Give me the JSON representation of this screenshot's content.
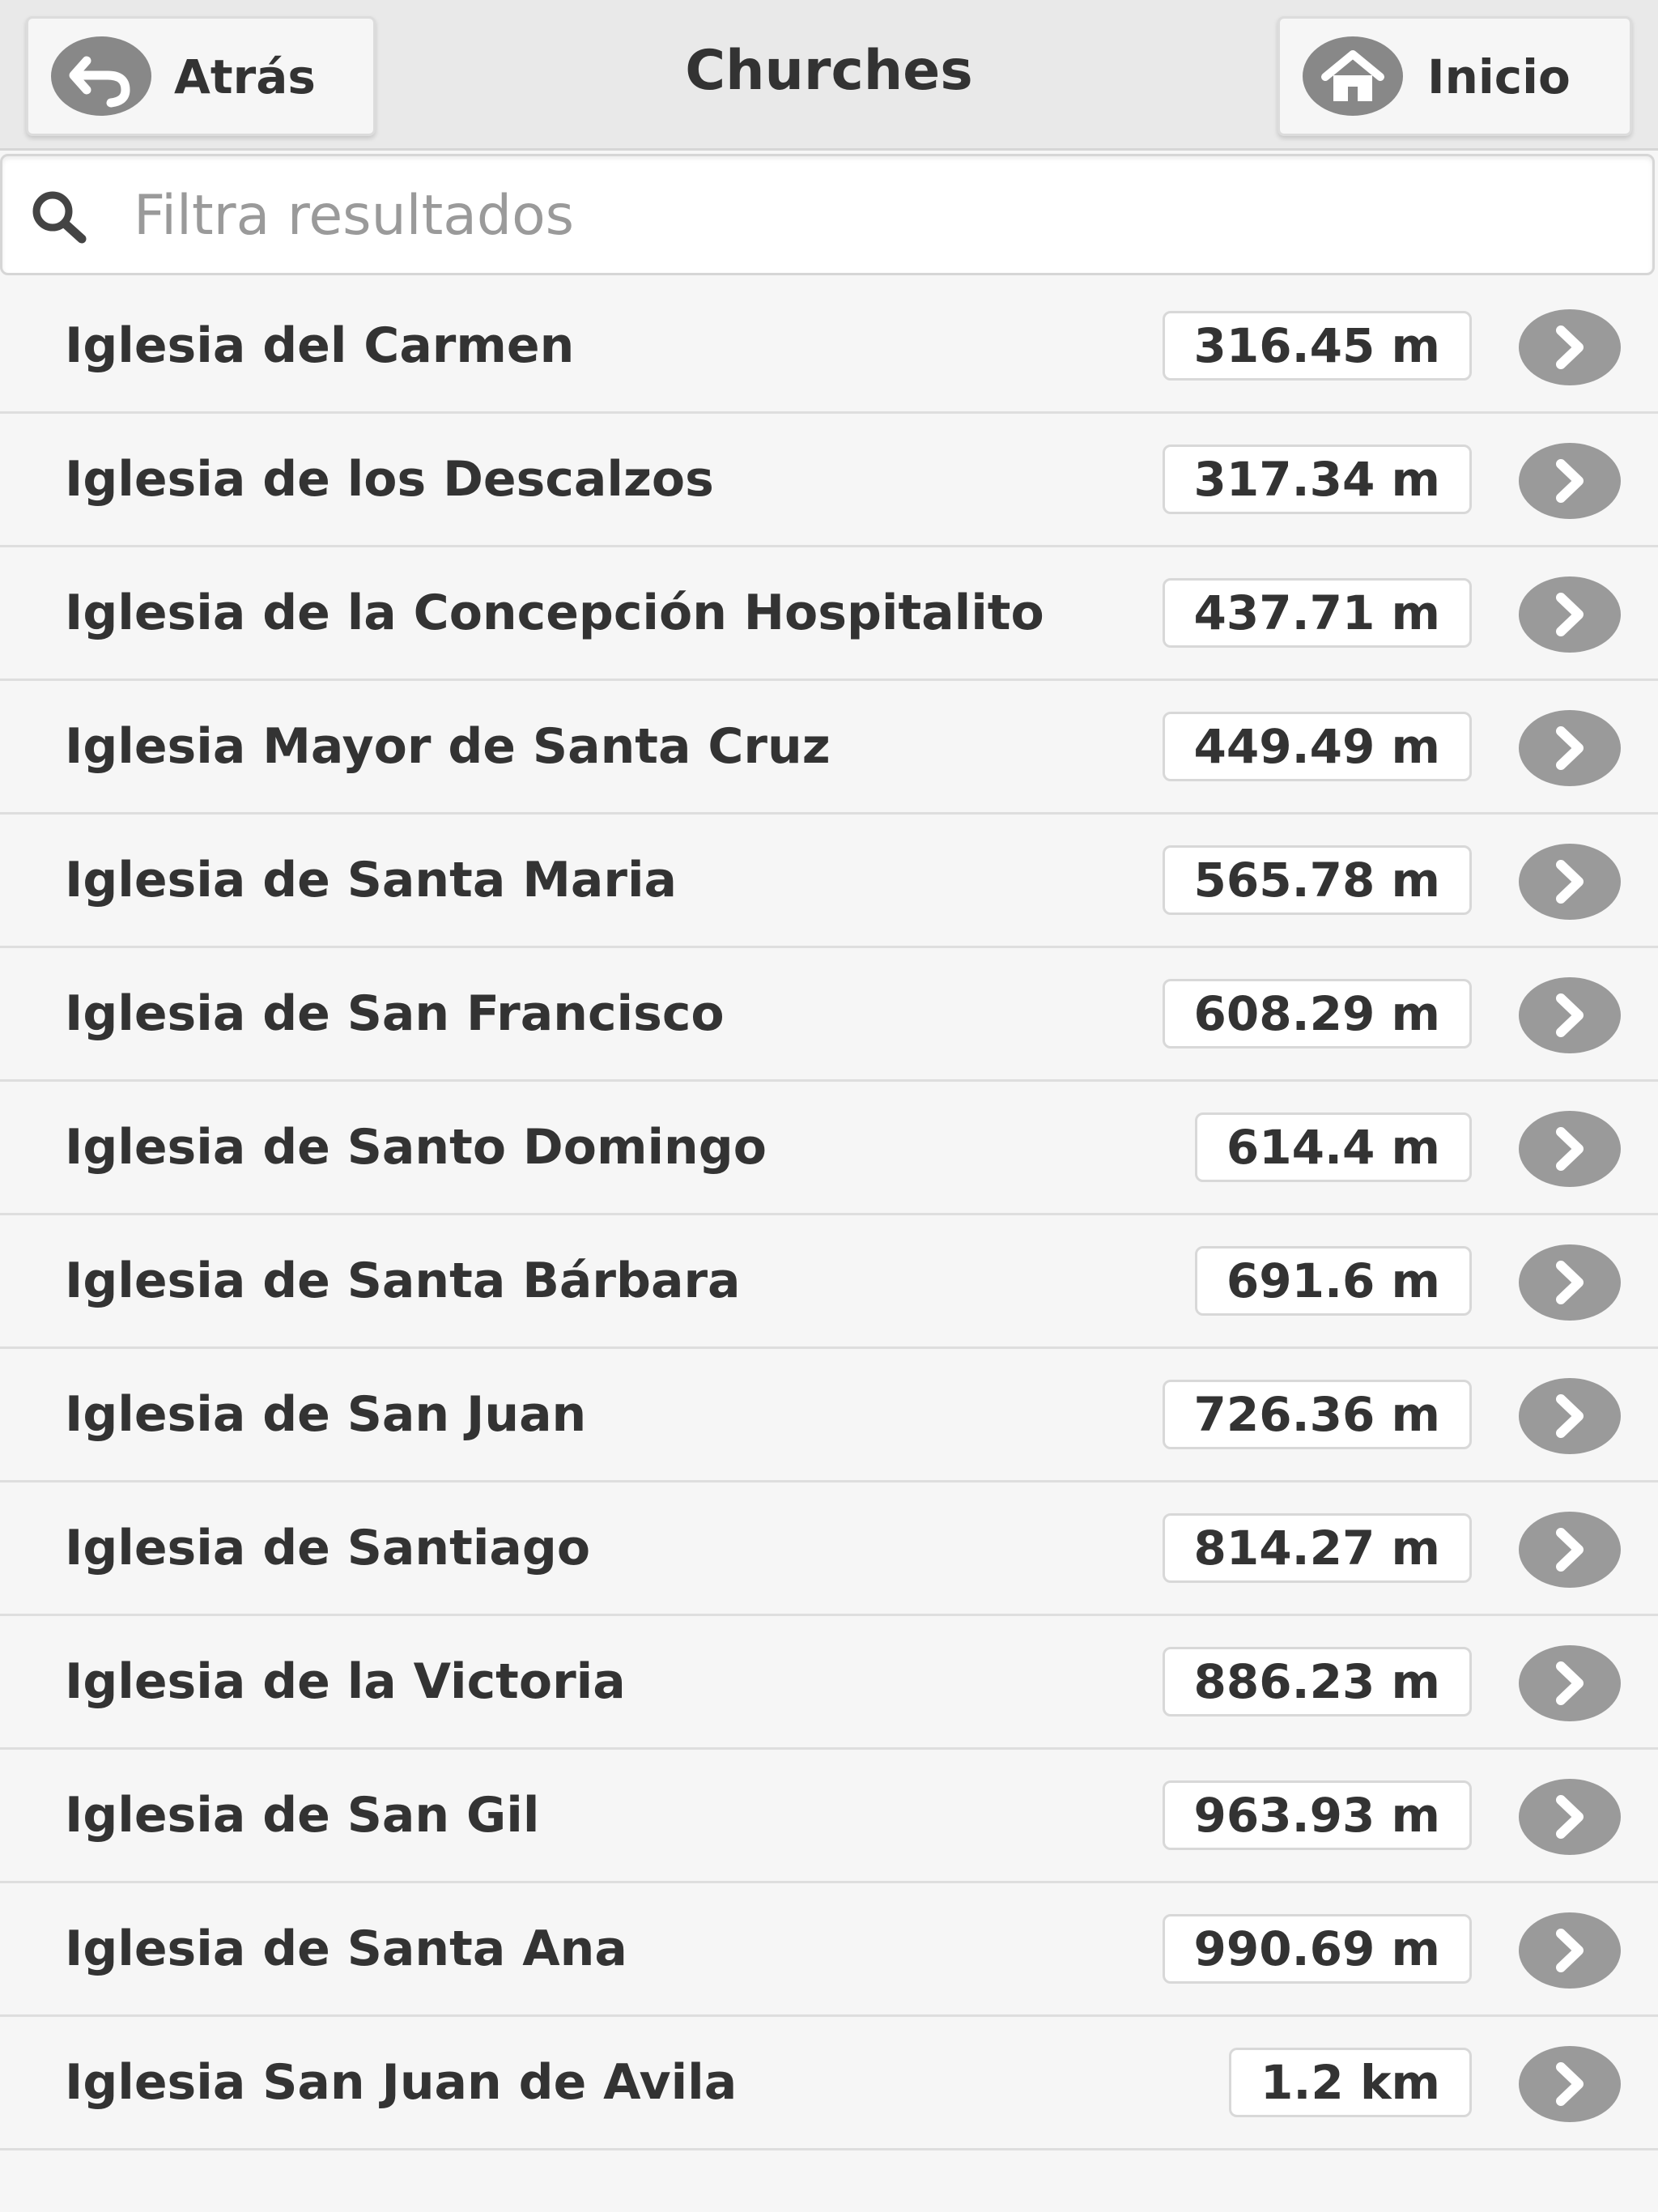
{
  "header": {
    "title": "Churches",
    "back_label": "Atrás",
    "home_label": "Inicio"
  },
  "search": {
    "placeholder": "Filtra resultados",
    "value": ""
  },
  "results": [
    {
      "name": "Iglesia del Carmen",
      "distance": "316.45 m"
    },
    {
      "name": "Iglesia de los Descalzos",
      "distance": "317.34 m"
    },
    {
      "name": "Iglesia de la Concepción Hospitalito",
      "distance": "437.71 m"
    },
    {
      "name": "Iglesia Mayor de Santa Cruz",
      "distance": "449.49 m"
    },
    {
      "name": "Iglesia de Santa Maria",
      "distance": "565.78 m"
    },
    {
      "name": "Iglesia de San Francisco",
      "distance": "608.29 m"
    },
    {
      "name": "Iglesia de Santo Domingo",
      "distance": "614.4 m"
    },
    {
      "name": "Iglesia de Santa Bárbara",
      "distance": "691.6 m"
    },
    {
      "name": "Iglesia de San Juan",
      "distance": "726.36 m"
    },
    {
      "name": "Iglesia de Santiago",
      "distance": "814.27 m"
    },
    {
      "name": "Iglesia de la Victoria",
      "distance": "886.23 m"
    },
    {
      "name": "Iglesia de San Gil",
      "distance": "963.93 m"
    },
    {
      "name": "Iglesia de Santa Ana",
      "distance": "990.69 m"
    },
    {
      "name": "Iglesia San Juan de Avila",
      "distance": "1.2 km"
    }
  ],
  "icons": {
    "back": "back-arrow-icon",
    "home": "home-icon",
    "search": "search-icon",
    "row_action": "chevron-right-icon"
  },
  "colors": {
    "header_bg": "#e9e9e9",
    "page_bg": "#f6f6f6",
    "icon_circle": "#888888",
    "text": "#333333"
  }
}
